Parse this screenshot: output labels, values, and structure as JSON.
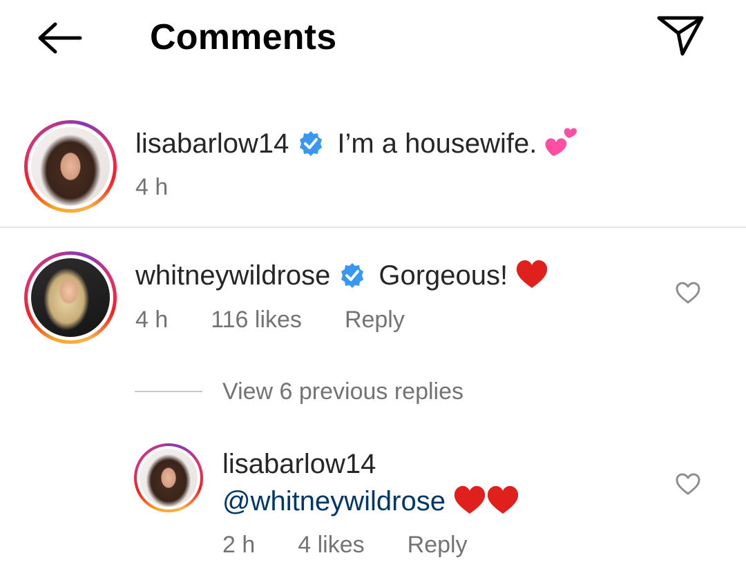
{
  "header": {
    "title": "Comments",
    "back_icon": "arrow-left-icon",
    "share_icon": "paper-plane-icon"
  },
  "caption": {
    "username": "lisabarlow14",
    "verified": true,
    "text": "I’m a housewife.",
    "emoji": "two-hearts-icon",
    "time": "4 h"
  },
  "comment": {
    "username": "whitneywildrose",
    "verified": true,
    "text": "Gorgeous!",
    "emoji": "red-heart-icon",
    "time": "4 h",
    "likes": "116 likes",
    "reply_label": "Reply"
  },
  "view_replies": "View 6 previous replies",
  "reply": {
    "username": "lisabarlow14",
    "mention": "@whitneywildrose",
    "emoji": "two-red-hearts-icon",
    "time": "2 h",
    "likes": "4 likes",
    "reply_label": "Reply"
  },
  "colors": {
    "text": "#262626",
    "meta": "#737373",
    "mention": "#00376b",
    "verified": "#3897f0",
    "heart": "#e0201c",
    "divider": "#e3e3e3"
  }
}
